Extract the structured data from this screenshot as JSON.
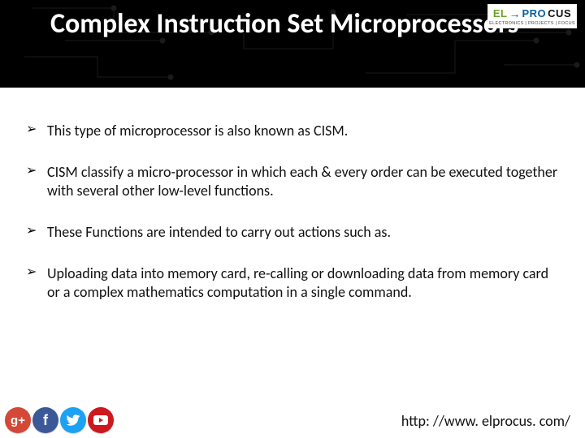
{
  "header": {
    "title": "Complex Instruction Set Microprocessors"
  },
  "logo": {
    "part_el": "EL",
    "part_arrow": "→",
    "part_pro": "PRO",
    "part_cus": "CUS",
    "tagline": "ELECTRONICS | PROJECTS | FOCUS"
  },
  "bullets": [
    "This type of microprocessor is also known as CISM.",
    "CISM classify a micro-processor in which each & every order can be executed together with several other low-level functions.",
    "These Functions are intended to carry out actions such as.",
    "Uploading data into memory card, re-calling or downloading data from memory card or a complex mathematics computation in a single command."
  ],
  "social": {
    "gplus": "g+",
    "fb": "f",
    "tw_name": "twitter-icon",
    "yt_name": "youtube-icon"
  },
  "footer": {
    "url": "http: //www. elprocus. com/"
  }
}
